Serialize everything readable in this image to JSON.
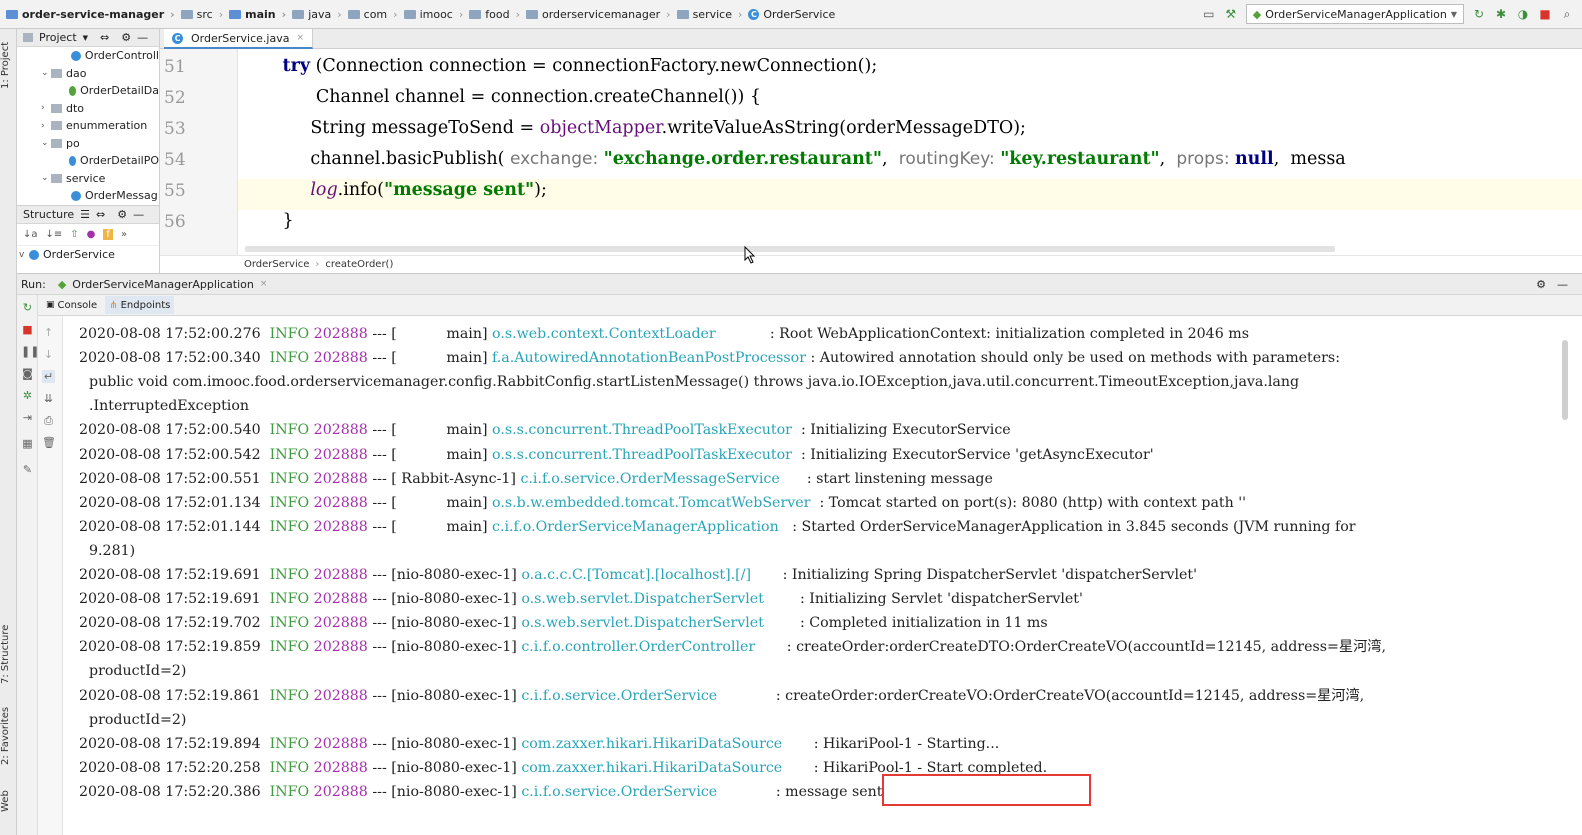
{
  "navbar": {
    "crumbs": [
      {
        "label": "order-service-manager",
        "bold": true
      },
      {
        "label": "src"
      },
      {
        "label": "main",
        "bold": true
      },
      {
        "label": "java"
      },
      {
        "label": "com"
      },
      {
        "label": "imooc"
      },
      {
        "label": "food"
      },
      {
        "label": "orderservicemanager"
      },
      {
        "label": "service"
      },
      {
        "label": "OrderService",
        "class_icon": true
      }
    ],
    "run_config": "OrderServiceManagerApplication"
  },
  "left_strip": {
    "project_tab": "1: Project",
    "structure_tab": "7: Structure",
    "favorites_tab": "2: Favorites",
    "web_tab": "Web"
  },
  "project": {
    "title": "Project",
    "items": [
      {
        "label": "OrderControll",
        "indent": 4,
        "kind": "class"
      },
      {
        "label": "dao",
        "indent": 2,
        "kind": "package",
        "arrow": "v"
      },
      {
        "label": "OrderDetailDa",
        "indent": 4,
        "kind": "interface"
      },
      {
        "label": "dto",
        "indent": 2,
        "kind": "package",
        "arrow": ">"
      },
      {
        "label": "enummeration",
        "indent": 2,
        "kind": "package",
        "arrow": ">"
      },
      {
        "label": "po",
        "indent": 2,
        "kind": "package",
        "arrow": "v"
      },
      {
        "label": "OrderDetailPO",
        "indent": 4,
        "kind": "class"
      },
      {
        "label": "service",
        "indent": 2,
        "kind": "package",
        "arrow": "v"
      },
      {
        "label": "OrderMessag",
        "indent": 4,
        "kind": "class"
      }
    ]
  },
  "structure": {
    "title": "Structure",
    "root": "OrderService"
  },
  "editor": {
    "tab": "OrderService.java",
    "breadcrumb": [
      "OrderService",
      "createOrder()"
    ],
    "lines": [
      {
        "num": "51",
        "segments": [
          [
            "plain",
            "        "
          ],
          [
            "kw",
            "try"
          ],
          [
            "plain",
            " (Connection connection = connectionFactory.newConnection();"
          ]
        ]
      },
      {
        "num": "52",
        "segments": [
          [
            "plain",
            "              Channel channel = connection.createChannel()) {"
          ]
        ]
      },
      {
        "num": "53",
        "segments": [
          [
            "plain",
            "             String messageToSend = "
          ],
          [
            "fld",
            "objectMapper"
          ],
          [
            "plain",
            ".writeValueAsString(orderMessageDTO);"
          ]
        ]
      },
      {
        "num": "54",
        "segments": [
          [
            "plain",
            "             channel.basicPublish( "
          ],
          [
            "hint",
            "exchange: "
          ],
          [
            "str",
            "\"exchange.order.restaurant\""
          ],
          [
            "plain",
            ",  "
          ],
          [
            "hint",
            "routingKey: "
          ],
          [
            "str",
            "\"key.restaurant\""
          ],
          [
            "plain",
            ",  "
          ],
          [
            "hint",
            "props: "
          ],
          [
            "kw",
            "null"
          ],
          [
            "plain",
            ",  messa"
          ]
        ]
      },
      {
        "num": "55",
        "segments": [
          [
            "plain",
            "             "
          ],
          [
            "it",
            "log"
          ],
          [
            "plain",
            ".info("
          ],
          [
            "str",
            "\"message sent\""
          ],
          [
            "plain",
            ");"
          ]
        ]
      },
      {
        "num": "56",
        "segments": [
          [
            "plain",
            "        }"
          ]
        ]
      }
    ]
  },
  "run": {
    "label": "Run:",
    "app_tab": "OrderServiceManagerApplication",
    "console_tab": "Console",
    "endpoints_tab": "Endpoints"
  },
  "console": {
    "lines": [
      {
        "ts": "2020-08-08 17:52:00.276",
        "level": "INFO",
        "pid": "202888",
        "thread": "--- [           main]",
        "logger": "o.s.web.context.ContextLoader           ",
        "msg": ": Root WebApplicationContext: initialization completed in 2046 ms"
      },
      {
        "ts": "2020-08-08 17:52:00.340",
        "level": "INFO",
        "pid": "202888",
        "thread": "--- [           main]",
        "logger": "f.a.AutowiredAnnotationBeanPostProcessor",
        "msg": ": Autowired annotation should only be used on methods with parameters:"
      },
      {
        "cont": "public void com.imooc.food.orderservicemanager.config.RabbitConfig.startListenMessage() throws java.io.IOException,java.util.concurrent.TimeoutException,java.lang"
      },
      {
        "cont": ".InterruptedException"
      },
      {
        "ts": "2020-08-08 17:52:00.540",
        "level": "INFO",
        "pid": "202888",
        "thread": "--- [           main]",
        "logger": "o.s.s.concurrent.ThreadPoolTaskExecutor ",
        "msg": ": Initializing ExecutorService"
      },
      {
        "ts": "2020-08-08 17:52:00.542",
        "level": "INFO",
        "pid": "202888",
        "thread": "--- [           main]",
        "logger": "o.s.s.concurrent.ThreadPoolTaskExecutor ",
        "msg": ": Initializing ExecutorService 'getAsyncExecutor'"
      },
      {
        "ts": "2020-08-08 17:52:00.551",
        "level": "INFO",
        "pid": "202888",
        "thread": "--- [ Rabbit-Async-1]",
        "logger": "c.i.f.o.service.OrderMessageService     ",
        "msg": ": start linstening message"
      },
      {
        "ts": "2020-08-08 17:52:01.134",
        "level": "INFO",
        "pid": "202888",
        "thread": "--- [           main]",
        "logger": "o.s.b.w.embedded.tomcat.TomcatWebServer ",
        "msg": ": Tomcat started on port(s): 8080 (http) with context path ''"
      },
      {
        "ts": "2020-08-08 17:52:01.144",
        "level": "INFO",
        "pid": "202888",
        "thread": "--- [           main]",
        "logger": "c.i.f.o.OrderServiceManagerApplication  ",
        "msg": ": Started OrderServiceManagerApplication in 3.845 seconds (JVM running for"
      },
      {
        "cont": "9.281)"
      },
      {
        "ts": "2020-08-08 17:52:19.691",
        "level": "INFO",
        "pid": "202888",
        "thread": "--- [nio-8080-exec-1]",
        "logger": "o.a.c.c.C.[Tomcat].[localhost].[/]      ",
        "msg": ": Initializing Spring DispatcherServlet 'dispatcherServlet'"
      },
      {
        "ts": "2020-08-08 17:52:19.691",
        "level": "INFO",
        "pid": "202888",
        "thread": "--- [nio-8080-exec-1]",
        "logger": "o.s.web.servlet.DispatcherServlet       ",
        "msg": ": Initializing Servlet 'dispatcherServlet'"
      },
      {
        "ts": "2020-08-08 17:52:19.702",
        "level": "INFO",
        "pid": "202888",
        "thread": "--- [nio-8080-exec-1]",
        "logger": "o.s.web.servlet.DispatcherServlet       ",
        "msg": ": Completed initialization in 11 ms"
      },
      {
        "ts": "2020-08-08 17:52:19.859",
        "level": "INFO",
        "pid": "202888",
        "thread": "--- [nio-8080-exec-1]",
        "logger": "c.i.f.o.controller.OrderController      ",
        "msg": ": createOrder:orderCreateDTO:OrderCreateVO(accountId=12145, address=星河湾,"
      },
      {
        "cont": "productId=2)"
      },
      {
        "ts": "2020-08-08 17:52:19.861",
        "level": "INFO",
        "pid": "202888",
        "thread": "--- [nio-8080-exec-1]",
        "logger": "c.i.f.o.service.OrderService            ",
        "msg": ": createOrder:orderCreateVO:OrderCreateVO(accountId=12145, address=星河湾,"
      },
      {
        "cont": "productId=2)"
      },
      {
        "ts": "2020-08-08 17:52:19.894",
        "level": "INFO",
        "pid": "202888",
        "thread": "--- [nio-8080-exec-1]",
        "logger": "com.zaxxer.hikari.HikariDataSource      ",
        "msg": ": HikariPool-1 - Starting..."
      },
      {
        "ts": "2020-08-08 17:52:20.258",
        "level": "INFO",
        "pid": "202888",
        "thread": "--- [nio-8080-exec-1]",
        "logger": "com.zaxxer.hikari.HikariDataSource      ",
        "msg": ": HikariPool-1 - Start completed."
      },
      {
        "ts": "2020-08-08 17:52:20.386",
        "level": "INFO",
        "pid": "202888",
        "thread": "--- [nio-8080-exec-1]",
        "logger": "c.i.f.o.service.OrderService            ",
        "msg": ": message sent"
      }
    ]
  },
  "colors": {
    "info_level": "#3f9b3f",
    "pid": "#a42faa",
    "logger": "#2aa4b8",
    "highlight_box": "#e53935"
  }
}
